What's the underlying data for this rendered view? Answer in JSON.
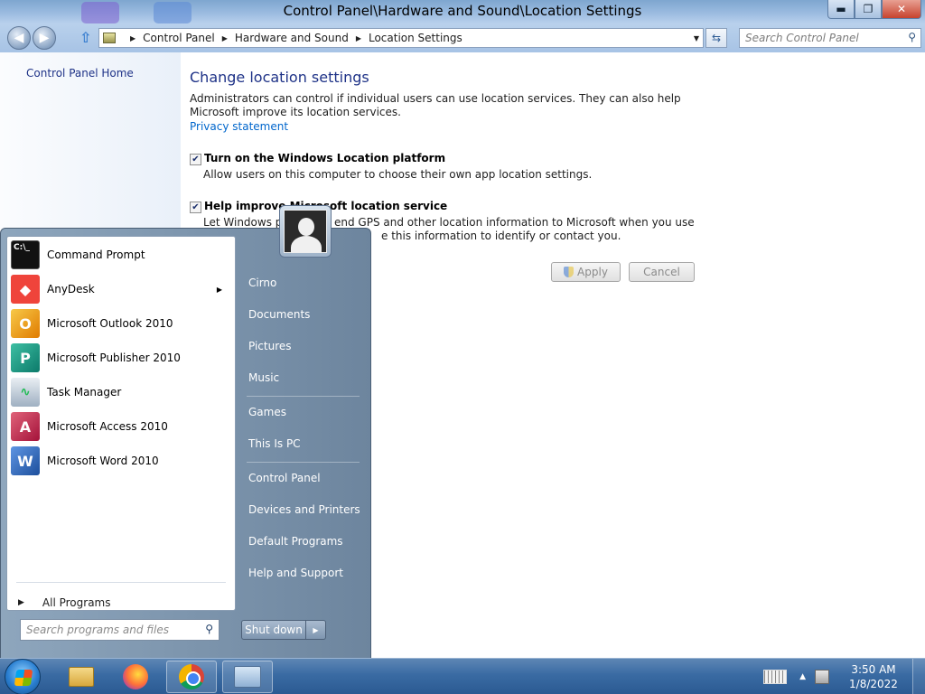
{
  "window": {
    "title": "Control Panel\\Hardware and Sound\\Location Settings",
    "buttons": {
      "minimize": "▬",
      "maximize": "❐",
      "close": "✕"
    }
  },
  "navigation": {
    "breadcrumb": [
      "Control Panel",
      "Hardware and Sound",
      "Location Settings"
    ],
    "search_placeholder": "Search Control Panel"
  },
  "left_pane": {
    "home_link": "Control Panel Home"
  },
  "content": {
    "heading": "Change location settings",
    "description": "Administrators can control if individual users can use location services. They can also help Microsoft improve its location services.",
    "privacy_link": "Privacy statement",
    "options": [
      {
        "checked": true,
        "label": "Turn on the Windows Location platform",
        "description": "Allow users on this computer to choose their own app location settings."
      },
      {
        "checked": true,
        "label": "Help improve Microsoft location service",
        "description_line1": "Let Windows pe",
        "description_line1b": "end GPS and other location information to Microsoft when you use",
        "description_line2": "e this information to identify or contact you."
      }
    ],
    "apply_label": "Apply",
    "cancel_label": "Cancel"
  },
  "start_menu": {
    "programs": [
      {
        "label": "Command Prompt",
        "icon": "command-prompt-icon",
        "has_submenu": false
      },
      {
        "label": "AnyDesk",
        "icon": "anydesk-icon",
        "has_submenu": true
      },
      {
        "label": "Microsoft Outlook 2010",
        "icon": "outlook-icon",
        "has_submenu": false
      },
      {
        "label": "Microsoft Publisher 2010",
        "icon": "publisher-icon",
        "has_submenu": false
      },
      {
        "label": "Task Manager",
        "icon": "task-manager-icon",
        "has_submenu": false
      },
      {
        "label": "Microsoft Access 2010",
        "icon": "access-icon",
        "has_submenu": false
      },
      {
        "label": "Microsoft Word 2010",
        "icon": "word-icon",
        "has_submenu": false
      }
    ],
    "all_programs": "All Programs",
    "search_placeholder": "Search programs and files",
    "right_links": [
      "Cirno",
      "Documents",
      "Pictures",
      "Music",
      "Games",
      "This Is PC",
      "Control Panel",
      "Devices and Printers",
      "Default Programs",
      "Help and Support"
    ],
    "shutdown_label": "Shut down"
  },
  "taskbar": {
    "time": "3:50 AM",
    "date": "1/8/2022",
    "pinned": [
      "file-explorer-icon",
      "firefox-icon",
      "chrome-icon",
      "control-panel-icon"
    ]
  },
  "colors": {
    "accent_heading": "#1e3287",
    "link": "#0066cc",
    "taskbar": "#3a6ba3"
  }
}
